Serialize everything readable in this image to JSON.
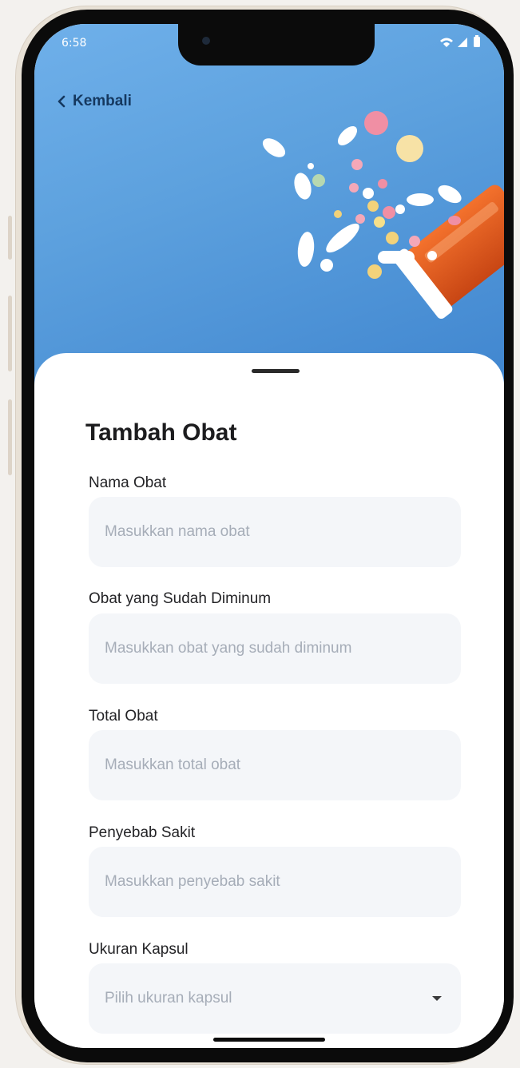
{
  "status_bar": {
    "time": "6:58"
  },
  "header": {
    "back_label": "Kembali"
  },
  "form": {
    "title": "Tambah Obat",
    "fields": [
      {
        "label": "Nama Obat",
        "placeholder": "Masukkan nama obat",
        "value": ""
      },
      {
        "label": "Obat yang Sudah Diminum",
        "placeholder": "Masukkan obat yang sudah diminum",
        "value": ""
      },
      {
        "label": "Total Obat",
        "placeholder": "Masukkan total obat",
        "value": ""
      },
      {
        "label": "Penyebab Sakit",
        "placeholder": "Masukkan penyebab sakit",
        "value": ""
      }
    ],
    "select": {
      "label": "Ukuran Kapsul",
      "placeholder": "Pilih ukuran kapsul"
    }
  },
  "icons": {
    "back": "chevron-left-icon",
    "wifi": "wifi-icon",
    "signal": "cellular-signal-icon",
    "battery": "battery-icon",
    "dropdown": "caret-down-icon"
  },
  "colors": {
    "hero_blue": "#5da1de",
    "back_text": "#15385f",
    "field_bg": "#f4f6f9",
    "placeholder": "#a6adb8"
  }
}
